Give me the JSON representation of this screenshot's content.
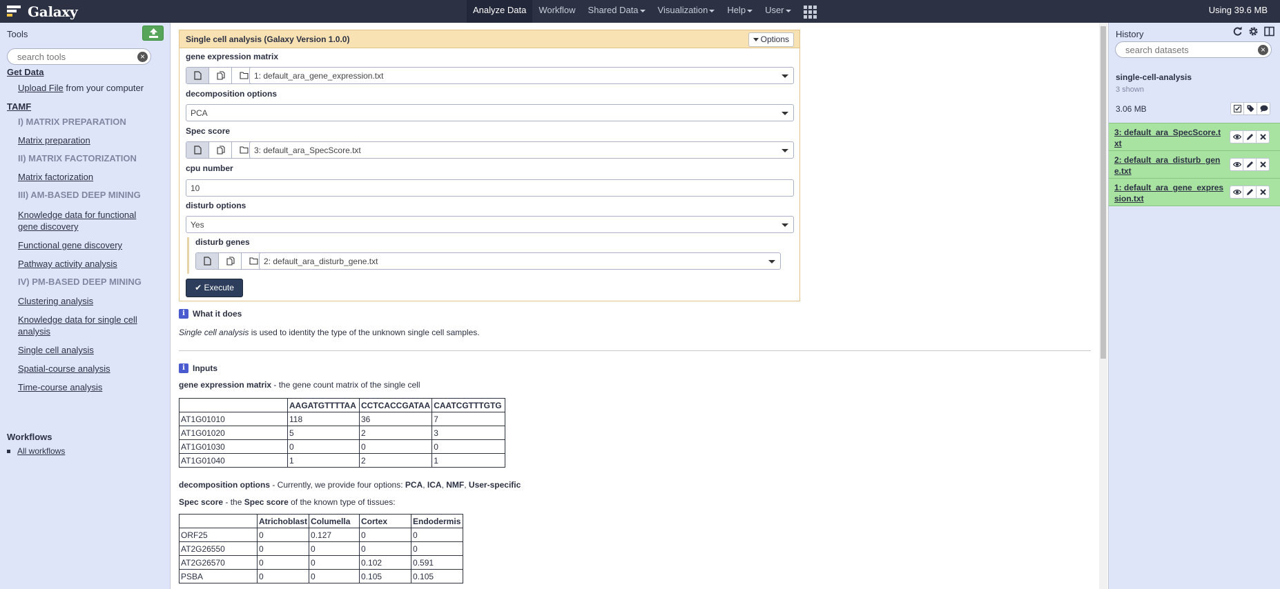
{
  "masthead": {
    "brand": "Galaxy",
    "nav": [
      {
        "label": "Analyze Data",
        "active": true,
        "dropdown": false
      },
      {
        "label": "Workflow",
        "active": false,
        "dropdown": false
      },
      {
        "label": "Shared Data",
        "active": false,
        "dropdown": true
      },
      {
        "label": "Visualization",
        "active": false,
        "dropdown": true
      },
      {
        "label": "Help",
        "active": false,
        "dropdown": true
      },
      {
        "label": "User",
        "active": false,
        "dropdown": true
      }
    ],
    "quota": "Using 39.6 MB"
  },
  "tools": {
    "title": "Tools",
    "search_placeholder": "search tools",
    "get_data": {
      "section": "Get Data",
      "upload_link": "Upload File",
      "upload_suffix": " from your computer"
    },
    "tamf": {
      "section": "TAMF",
      "items": [
        {
          "label": "I) MATRIX PREPARATION",
          "kind": "label"
        },
        {
          "label": "Matrix preparation",
          "kind": "link"
        },
        {
          "label": "II) MATRIX FACTORIZATION",
          "kind": "label"
        },
        {
          "label": "Matrix factorization",
          "kind": "link"
        },
        {
          "label": "III) AM-BASED DEEP MINING",
          "kind": "label"
        },
        {
          "label": "Knowledge data for functional gene discovery",
          "kind": "link"
        },
        {
          "label": "Functional gene discovery",
          "kind": "link"
        },
        {
          "label": "Pathway activity analysis",
          "kind": "link"
        },
        {
          "label": "IV) PM-BASED DEEP MINING",
          "kind": "label"
        },
        {
          "label": "Clustering analysis",
          "kind": "link"
        },
        {
          "label": "Knowledge data for single cell analysis",
          "kind": "link"
        },
        {
          "label": "Single cell analysis",
          "kind": "link"
        },
        {
          "label": "Spatial-course analysis",
          "kind": "link"
        },
        {
          "label": "Time-course analysis",
          "kind": "link"
        }
      ]
    },
    "workflows_title": "Workflows",
    "all_workflows": "All workflows"
  },
  "form": {
    "title": "Single cell analysis (Galaxy Version 1.0.0)",
    "options_label": "Options",
    "fields": {
      "gene_expression_matrix": {
        "label": "gene expression matrix",
        "value": "1: default_ara_gene_expression.txt"
      },
      "decomposition_options": {
        "label": "decomposition options",
        "value": "PCA"
      },
      "spec_score": {
        "label": "Spec score",
        "value": "3: default_ara_SpecScore.txt"
      },
      "cpu_number": {
        "label": "cpu number",
        "value": "10"
      },
      "disturb_options": {
        "label": "disturb options",
        "value": "Yes"
      },
      "disturb_genes": {
        "label": "disturb genes",
        "value": "2: default_ara_disturb_gene.txt"
      }
    },
    "execute_label": "Execute"
  },
  "help": {
    "what_it_does_heading": "What it does",
    "what_it_does_em": "Single cell analysis",
    "what_it_does_rest": " is used to identity the type of the unknown single cell samples.",
    "inputs_heading": "Inputs",
    "gem_term": "gene expression matrix",
    "gem_desc": " - the gene count matrix of the single cell",
    "gem_table": {
      "headers": [
        "",
        "AAGATGTTTTAA",
        "CCTCACCGATAA",
        "CAATCGTTTGTG"
      ],
      "rows": [
        [
          "AT1G01010",
          "118",
          "36",
          "7"
        ],
        [
          "AT1G01020",
          "5",
          "2",
          "3"
        ],
        [
          "AT1G01030",
          "0",
          "0",
          "0"
        ],
        [
          "AT1G01040",
          "1",
          "2",
          "1"
        ]
      ]
    },
    "decomp_term": "decomposition options",
    "decomp_desc": " - Currently, we provide four options: ",
    "decomp_options": [
      "PCA",
      "ICA",
      "NMF",
      "User-specific"
    ],
    "spec_term": "Spec score",
    "spec_desc_pre": " - the ",
    "spec_desc_bold": "Spec score",
    "spec_desc_post": " of the known type of tissues:",
    "spec_table": {
      "headers": [
        "",
        "Atrichoblast",
        "Columella",
        "Cortex",
        "Endodermis"
      ],
      "rows": [
        [
          "ORF25",
          "0",
          "0.127",
          "0",
          "0"
        ],
        [
          "AT2G26550",
          "0",
          "0",
          "0",
          "0"
        ],
        [
          "AT2G26570",
          "0",
          "0",
          "0.102",
          "0.591"
        ],
        [
          "PSBA",
          "0",
          "0",
          "0.105",
          "0.105"
        ]
      ]
    }
  },
  "history": {
    "title": "History",
    "search_placeholder": "search datasets",
    "name": "single-cell-analysis",
    "shown": "3 shown",
    "size": "3.06 MB",
    "datasets": [
      {
        "title": "3: default_ara_SpecScore.txt"
      },
      {
        "title": "2: default_ara_disturb_gene.txt"
      },
      {
        "title": "1: default_ara_gene_expression.txt"
      }
    ],
    "dataset_color": "#a9e3a1"
  },
  "colors": {
    "masthead": "#2c3143",
    "panel": "#dfe5f9",
    "form_header": "#f8e1b3",
    "execute": "#2c3e5c"
  }
}
